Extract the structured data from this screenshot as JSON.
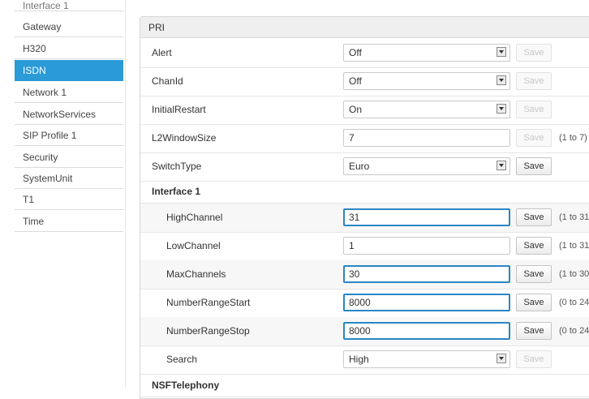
{
  "sidebar": {
    "items": [
      {
        "label": "Interface 1"
      },
      {
        "label": "Gateway"
      },
      {
        "label": "H320"
      },
      {
        "label": "ISDN"
      },
      {
        "label": "Network 1"
      },
      {
        "label": "NetworkServices"
      },
      {
        "label": "SIP Profile 1"
      },
      {
        "label": "Security"
      },
      {
        "label": "SystemUnit"
      },
      {
        "label": "T1"
      },
      {
        "label": "Time"
      }
    ],
    "active": "ISDN"
  },
  "panel": {
    "title": "PRI",
    "save_label": "Save",
    "rows": [
      {
        "label": "Alert",
        "value": "Off"
      },
      {
        "label": "ChanId",
        "value": "Off"
      },
      {
        "label": "InitialRestart",
        "value": "On"
      },
      {
        "label": "L2WindowSize",
        "value": "7",
        "range": "(1 to 7)"
      },
      {
        "label": "SwitchType",
        "value": "Euro"
      }
    ],
    "section": "Interface 1",
    "interface_rows": [
      {
        "label": "HighChannel",
        "value": "31",
        "range": "(1 to 31"
      },
      {
        "label": "LowChannel",
        "value": "1",
        "range": "(1 to 31"
      },
      {
        "label": "MaxChannels",
        "value": "30",
        "range": "(1 to 30"
      },
      {
        "label": "NumberRangeStart",
        "value": "8000",
        "range": "(0 to 24"
      },
      {
        "label": "NumberRangeStop",
        "value": "8000",
        "range": "(0 to 24"
      },
      {
        "label": "Search",
        "value": "High"
      }
    ],
    "next_section": "NSFTelephony"
  }
}
